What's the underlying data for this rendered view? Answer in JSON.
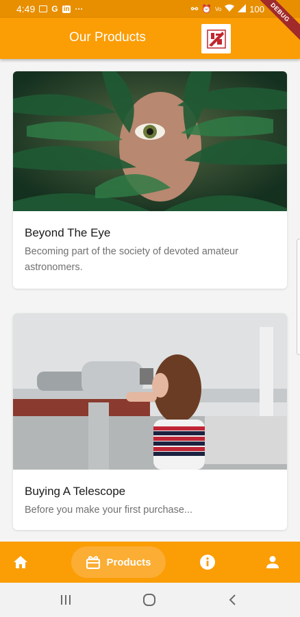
{
  "status_bar": {
    "time": "4:49",
    "left_icons": [
      "image-icon",
      "google-icon",
      "linkedin-icon",
      "more-icon"
    ],
    "right_icons": [
      "link-icon",
      "alarm-icon",
      "vowifi-icon",
      "wifi-icon",
      "signal-icon"
    ],
    "battery": "100"
  },
  "app_bar": {
    "title": "Our Products",
    "debug_label": "DEBUG"
  },
  "cards": [
    {
      "title": "Beyond The Eye",
      "description": "Becoming part of the society of devoted amateur astronomers."
    },
    {
      "title": "Buying A Telescope",
      "description": "Before you make your first purchase..."
    }
  ],
  "bottom_nav": {
    "items": [
      {
        "icon": "home-icon",
        "label": ""
      },
      {
        "icon": "products-icon",
        "label": "Products",
        "selected": true
      },
      {
        "icon": "info-icon",
        "label": ""
      },
      {
        "icon": "person-icon",
        "label": ""
      }
    ]
  },
  "system_nav": {
    "buttons": [
      "recents-icon",
      "home-circle-icon",
      "back-icon"
    ]
  },
  "colors": {
    "primary": "#fb9d05",
    "status_bar": "#e88f00",
    "selected_pill": "#fbad34",
    "debug_ribbon": "#a12a2a"
  }
}
